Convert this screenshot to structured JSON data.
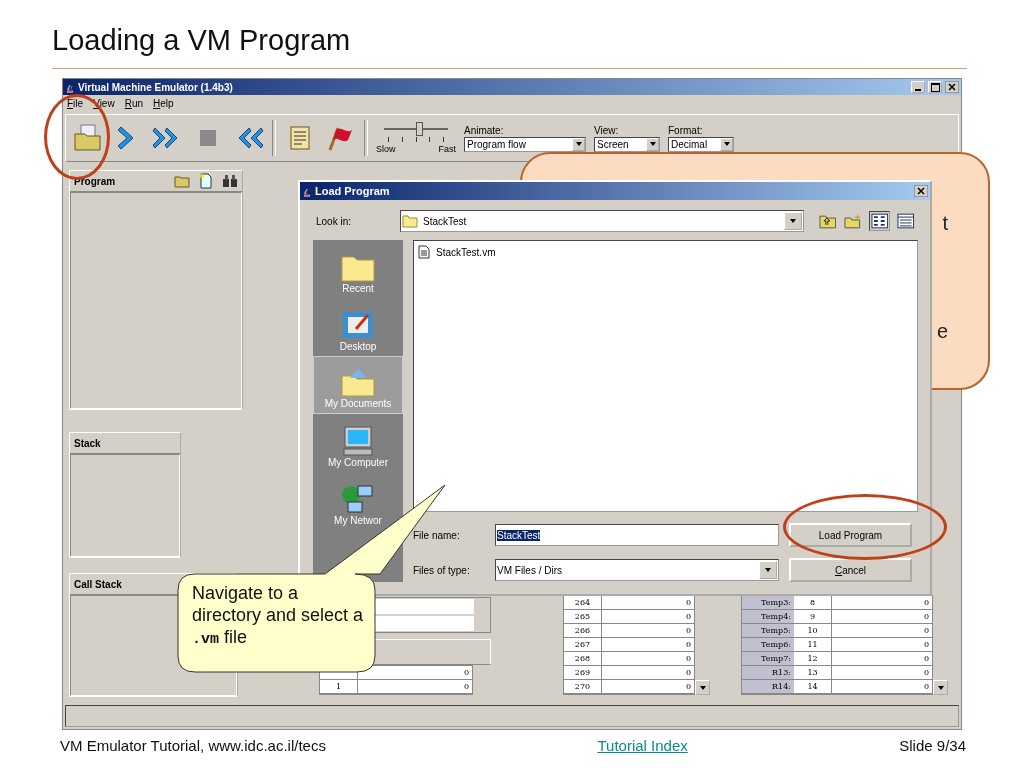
{
  "slide": {
    "title": "Loading a VM Program"
  },
  "emulator": {
    "title": "Virtual Machine Emulator (1.4b3)",
    "menu": [
      "File",
      "View",
      "Run",
      "Help"
    ],
    "toolbar": {
      "speed": {
        "slow": "Slow",
        "fast": "Fast",
        "level": 0.55
      },
      "animate": {
        "label": "Animate:",
        "value": "Program flow"
      },
      "view": {
        "label": "View:",
        "value": "Screen"
      },
      "format": {
        "label": "Format:",
        "value": "Decimal"
      }
    },
    "panels": {
      "program": "Program",
      "stack": "Stack",
      "call_stack": "Call Stack"
    },
    "small_table": {
      "rows": [
        {
          "value": "0"
        },
        {
          "index": "1",
          "value": "0"
        }
      ]
    },
    "ram": {
      "rows": [
        [
          "264",
          "0"
        ],
        [
          "265",
          "0"
        ],
        [
          "266",
          "0"
        ],
        [
          "267",
          "0"
        ],
        [
          "268",
          "0"
        ],
        [
          "269",
          "0"
        ],
        [
          "270",
          "0"
        ]
      ]
    },
    "segments": {
      "rows": [
        [
          "Temp3:",
          "8",
          "0"
        ],
        [
          "Temp4:",
          "9",
          "0"
        ],
        [
          "Temp5:",
          "10",
          "0"
        ],
        [
          "Temp6:",
          "11",
          "0"
        ],
        [
          "Temp7:",
          "12",
          "0"
        ],
        [
          "R13:",
          "13",
          "0"
        ],
        [
          "R14:",
          "14",
          "0"
        ]
      ]
    }
  },
  "dialog": {
    "title": "Load Program",
    "look_in": {
      "label": "Look in:",
      "value": "StackTest"
    },
    "places": [
      {
        "label": "Recent",
        "selected": false
      },
      {
        "label": "Desktop",
        "selected": false
      },
      {
        "label": "My Documents",
        "selected": true
      },
      {
        "label": "My Computer",
        "selected": false
      },
      {
        "label": "My Networ",
        "selected": false
      }
    ],
    "files": [
      {
        "name": "StackTest.vm"
      }
    ],
    "file_name": {
      "label": "File name:",
      "value": "StackTest",
      "text_selected": true
    },
    "file_type": {
      "label": "Files of type:",
      "value": "VM Files / Dirs"
    },
    "buttons": [
      "Load Program",
      "Cancel"
    ]
  },
  "note_callout": {
    "text_fragments": [
      "t",
      "e"
    ]
  },
  "hint_callout": {
    "text": "Navigate to a directory and select a **.vm** file"
  },
  "footer": {
    "left": "VM Emulator Tutorial, www.idc.ac.il/tecs",
    "link": "Tutorial Index",
    "right": "Slide 9/34"
  }
}
